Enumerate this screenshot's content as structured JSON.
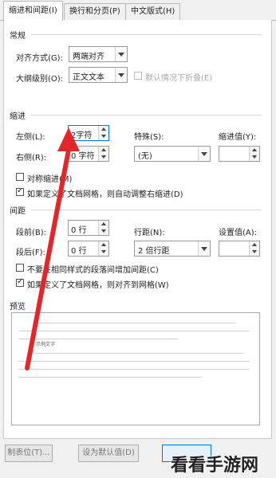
{
  "tabs": [
    "缩进和间距(I)",
    "换行和分页(P)",
    "中文版式(H)"
  ],
  "general": {
    "title": "常规",
    "alignment_label": "对齐方式(G):",
    "alignment_value": "两端对齐",
    "outline_label": "大纲级别(O):",
    "outline_value": "正文文本",
    "collapsed_label": "默认情况下折叠(E)"
  },
  "indent": {
    "title": "缩进",
    "left_label": "左侧(L):",
    "left_value": "2字符",
    "right_label": "右侧(R):",
    "right_value": "0 字符",
    "special_label": "特殊(S):",
    "special_value": "(无)",
    "indent_value_label": "缩进值(Y):",
    "indent_value": "",
    "mirror_label": "对称缩进(M)",
    "mirror_checked": false,
    "autoadjust_label": "如果定义了文档网格，则自动调整右缩进(D)",
    "autoadjust_checked": true
  },
  "spacing": {
    "title": "间距",
    "before_label": "段前(B):",
    "before_value": "0 行",
    "after_label": "段后(F):",
    "after_value": "0 行",
    "line_label": "行距(N):",
    "line_value": "2 倍行距",
    "setting_label": "设置值(A):",
    "setting_value": "",
    "no_space_label": "不要在相同样式的段落间增加间距(C)",
    "no_space_checked": false,
    "snap_label": "如果定义了文档网格，则对齐到网格(W)",
    "snap_checked": true
  },
  "preview": {
    "title": "预览",
    "sample": "示例文字"
  },
  "buttons": {
    "tabs": "制表位(T)...",
    "default": "设为默认值(D)"
  },
  "watermark": "看看手游网",
  "colors": {
    "arrow": "#e3262c",
    "focus": "#0078d7"
  }
}
